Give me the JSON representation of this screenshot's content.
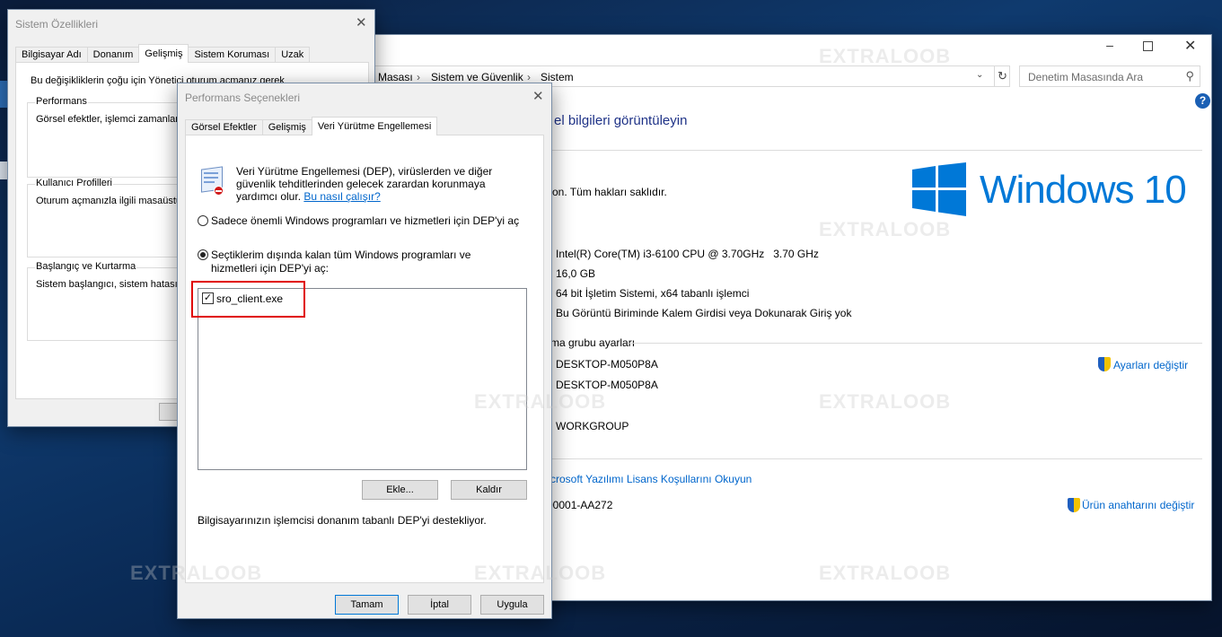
{
  "control_panel": {
    "breadcrumb": [
      "Masası",
      "Sistem ve Güvenlik",
      "Sistem"
    ],
    "search_placeholder": "Denetim Masasında Ara",
    "heading": "el bilgileri görüntüleyin",
    "rights": "on. Tüm hakları saklıdır.",
    "logo_text": "Windows 10",
    "logo_color": "#0078d7",
    "processor": "Intel(R) Core(TM) i3-6100 CPU @ 3.70GHz   3.70 GHz",
    "memory": "16,0 GB",
    "system_type": "64 bit İşletim Sistemi, x64 tabanlı işlemci",
    "pen_touch": "Bu Görüntü Biriminde Kalem Girdisi veya Dokunarak Giriş yok",
    "workgroup_section": "ma grubu ayarları",
    "computer_name": "DESKTOP-M050P8A",
    "full_name": "DESKTOP-M050P8A",
    "workgroup": "WORKGROUP",
    "change_settings": "Ayarları değiştir",
    "license_link": "crosoft Yazılımı Lisans Koşullarını Okuyun",
    "product_id": "00001-AA272",
    "change_key": "Ürün anahtarını değiştir"
  },
  "sys_props": {
    "title": "Sistem Özellikleri",
    "tabs": [
      "Bilgisayar Adı",
      "Donanım",
      "Gelişmiş",
      "Sistem Koruması",
      "Uzak"
    ],
    "intro": "Bu değişikliklerin çoğu için Yönetici oturum açmanız gerek",
    "perf_label": "Performans",
    "perf_text": "Görsel efektler, işlemci zamanlama",
    "profiles_label": "Kullanıcı Profilleri",
    "profiles_text": "Oturum açmanızla ilgili masaüstü a",
    "startup_label": "Başlangıç ve Kurtarma",
    "startup_text": "Sistem başlangıcı, sistem hatası ve"
  },
  "perf_opts": {
    "title": "Performans Seçenekleri",
    "tabs": [
      "Görsel Efektler",
      "Gelişmiş",
      "Veri Yürütme Engellemesi"
    ],
    "description": "Veri Yürütme Engellemesi (DEP), virüslerden ve diğer güvenlik tehditlerinden gelecek zarardan korunmaya yardımcı olur.",
    "help_link": "Bu nasıl çalışır?",
    "option1": "Sadece önemli Windows programları ve hizmetleri için DEP'yi aç",
    "option2": "Seçtiklerim dışında kalan tüm Windows programları ve hizmetleri için DEP'yi aç:",
    "list_items": [
      "sro_client.exe"
    ],
    "highlight_color": "#e00000",
    "add_button": "Ekle...",
    "remove_button": "Kaldır",
    "support_text": "Bilgisayarınızın işlemcisi donanım tabanlı DEP'yi destekliyor.",
    "ok_button": "Tamam",
    "cancel_button": "İptal",
    "apply_button": "Uygula"
  },
  "watermark": "EXTRALOOB"
}
